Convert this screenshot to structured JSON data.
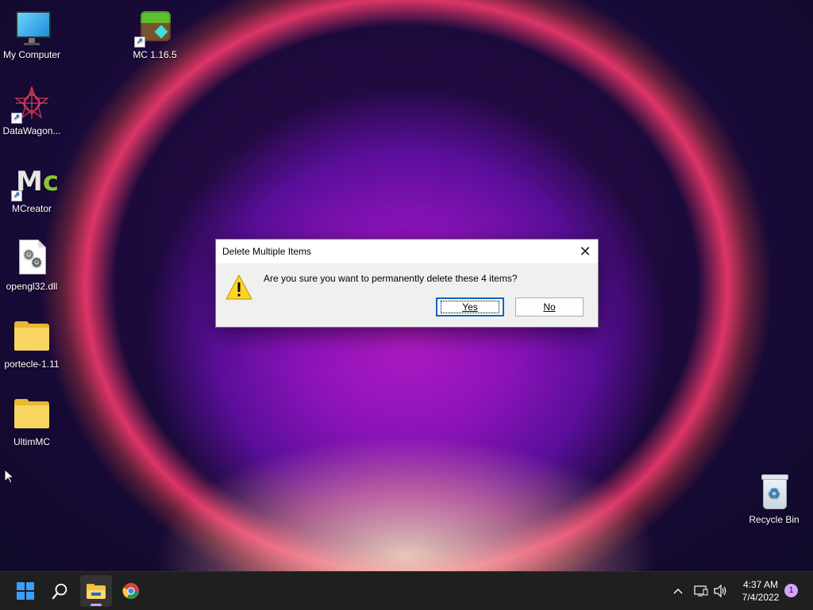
{
  "desktop": {
    "icons": [
      {
        "label": "My Computer",
        "icon": "monitor-icon"
      },
      {
        "label": "MC 1.16.5",
        "icon": "minecraft-icon",
        "shortcut": true
      },
      {
        "label": "DataWagon...",
        "icon": "datawagon-icon",
        "shortcut": true
      },
      {
        "label": "MCreator",
        "icon": "mcreator-icon",
        "shortcut": true
      },
      {
        "label": "opengl32.dll",
        "icon": "dll-file-icon"
      },
      {
        "label": "portecle-1.11",
        "icon": "folder-icon"
      },
      {
        "label": "UltimMC",
        "icon": "folder-icon"
      },
      {
        "label": "Recycle Bin",
        "icon": "recycle-bin-icon"
      }
    ]
  },
  "dialog": {
    "title": "Delete Multiple Items",
    "close_glyph": "✕",
    "message": "Are you sure you want to permanently delete these 4 items?",
    "icon": "warning-icon",
    "yes_label": "Yes",
    "no_label": "No"
  },
  "taskbar": {
    "start_icon": "windows-start-icon",
    "search_icon": "search-icon",
    "apps": [
      {
        "name": "File Explorer",
        "icon": "file-explorer-icon",
        "active": true
      },
      {
        "name": "Google Chrome",
        "icon": "chrome-icon",
        "active": false
      }
    ],
    "tray": {
      "chevron_icon": "chevron-up-icon",
      "network_icon": "network-icon",
      "volume_icon": "volume-icon",
      "time": "4:37 AM",
      "date": "7/4/2022",
      "notification_count": "1"
    }
  },
  "colors": {
    "accent": "#0a64c4",
    "taskbar": "#1f1f1f",
    "notification_badge": "#d6a3ff"
  }
}
